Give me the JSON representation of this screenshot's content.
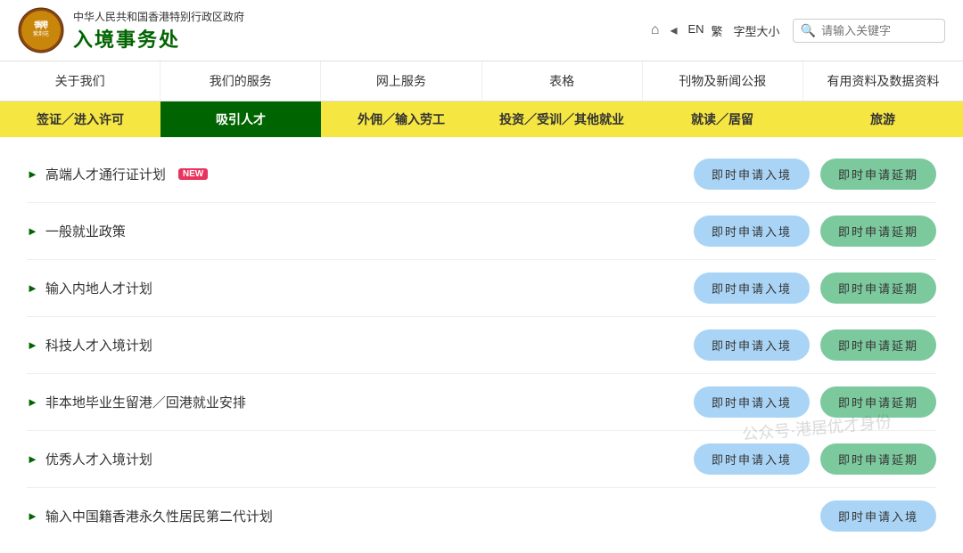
{
  "header": {
    "gov_name": "中华人民共和国香港特别行政区政府",
    "dept_name": "入境事务处",
    "icons": {
      "home": "⌂",
      "share": "◁",
      "en_label": "EN",
      "trad_label": "繁",
      "font_size_label": "字型大小"
    },
    "search_placeholder": "请输入关键字"
  },
  "main_nav": {
    "items": [
      {
        "label": "关于我们"
      },
      {
        "label": "我们的服务"
      },
      {
        "label": "网上服务"
      },
      {
        "label": "表格"
      },
      {
        "label": "刊物及新闻公报"
      },
      {
        "label": "有用资料及数据资料"
      }
    ]
  },
  "sub_nav": {
    "items": [
      {
        "label": "签证／进入许可",
        "style": "yellow"
      },
      {
        "label": "吸引人才",
        "style": "active"
      },
      {
        "label": "外佣／输入劳工",
        "style": "yellow"
      },
      {
        "label": "投资／受训／其他就业",
        "style": "yellow"
      },
      {
        "label": "就读／居留",
        "style": "yellow"
      },
      {
        "label": "旅游",
        "style": "yellow"
      }
    ]
  },
  "policies": [
    {
      "title": "高端人才通行证计划",
      "is_new": true,
      "btn_entry": "即时申请入境",
      "btn_extend": "即时申请延期"
    },
    {
      "title": "一般就业政策",
      "is_new": false,
      "btn_entry": "即时申请入境",
      "btn_extend": "即时申请延期"
    },
    {
      "title": "输入内地人才计划",
      "is_new": false,
      "btn_entry": "即时申请入境",
      "btn_extend": "即时申请延期"
    },
    {
      "title": "科技人才入境计划",
      "is_new": false,
      "btn_entry": "即时申请入境",
      "btn_extend": "即时申请延期"
    },
    {
      "title": "非本地毕业生留港／回港就业安排",
      "is_new": false,
      "btn_entry": "即时申请入境",
      "btn_extend": "即时申请延期"
    },
    {
      "title": "优秀人才入境计划",
      "is_new": false,
      "btn_entry": "即时申请入境",
      "btn_extend": "即时申请延期"
    },
    {
      "title": "输入中国籍香港永久性居民第二代计划",
      "is_new": false,
      "btn_entry": "即时申请入境",
      "btn_extend": ""
    }
  ],
  "new_badge_label": "NEW",
  "watermark": "公众号·港居优才身份"
}
